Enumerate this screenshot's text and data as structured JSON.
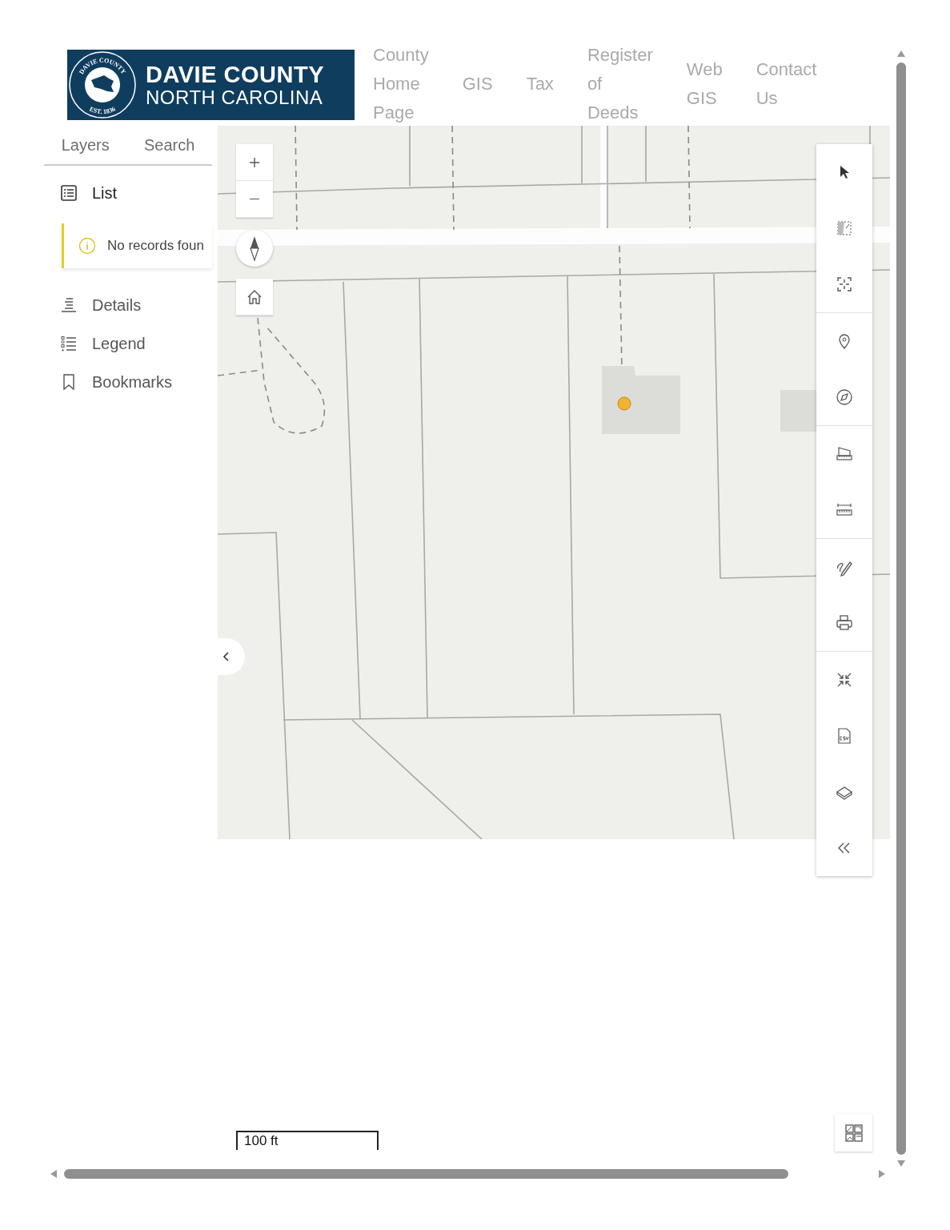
{
  "header": {
    "logo": {
      "seal_top": "DAVIE COUNTY",
      "seal_bottom": "EST. 1836",
      "title": "DAVIE COUNTY",
      "subtitle": "NORTH CAROLINA"
    },
    "nav": [
      "County Home Page",
      "GIS",
      "Tax",
      "Register of Deeds",
      "Web GIS",
      "Contact Us"
    ]
  },
  "side_panel": {
    "tabs": [
      {
        "label": "Layers",
        "selected": false
      },
      {
        "label": "Search",
        "selected": false
      }
    ],
    "sections": [
      {
        "label": "List",
        "expanded": true,
        "notice": "No records foun"
      },
      {
        "label": "Details",
        "expanded": false
      },
      {
        "label": "Legend",
        "expanded": false
      },
      {
        "label": "Bookmarks",
        "expanded": false
      }
    ]
  },
  "map": {
    "scale_bar": "100 ft"
  }
}
